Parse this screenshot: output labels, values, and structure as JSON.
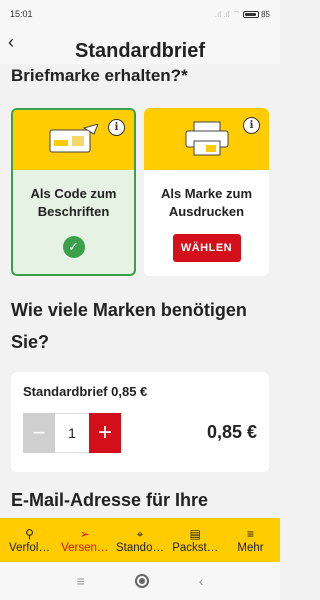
{
  "status_bar": {
    "time": "15:01",
    "signal": "…il …il",
    "battery": "85"
  },
  "header": {
    "title": "Standardbrief",
    "back_icon": "back-chevron-icon"
  },
  "section_heading_cut": "Briefmarke erhalten?*",
  "options": [
    {
      "label_line1": "Als Code zum",
      "label_line2": "Beschriften",
      "selected": true,
      "icon": "label-code-icon"
    },
    {
      "label_line1": "Als Marke zum",
      "label_line2": "Ausdrucken",
      "selected": false,
      "icon": "printer-icon",
      "button": "WÄHLEN"
    }
  ],
  "quantity_question": "Wie viele Marken benötigen Sie?",
  "quantity_card": {
    "label": "Standardbrief 0,85 €",
    "value": "1",
    "minus": "−",
    "plus": "+",
    "price": "0,85 €"
  },
  "email_heading": "E-Mail-Adresse für Ihre",
  "bottom_nav": [
    {
      "label": "Verfol…",
      "icon": "search-icon",
      "glyph": "⚲",
      "active": false
    },
    {
      "label": "Versen…",
      "icon": "send-icon",
      "glyph": "➢",
      "active": true
    },
    {
      "label": "Stando…",
      "icon": "location-pin-icon",
      "glyph": "⌖",
      "active": false
    },
    {
      "label": "Packst…",
      "icon": "packstation-icon",
      "glyph": "▤",
      "active": false
    },
    {
      "label": "Mehr",
      "icon": "menu-icon",
      "glyph": "≡",
      "active": false
    }
  ],
  "colors": {
    "brand_yellow": "#ffcc00",
    "brand_red": "#d30f1c",
    "success_green": "#3aa14a"
  }
}
